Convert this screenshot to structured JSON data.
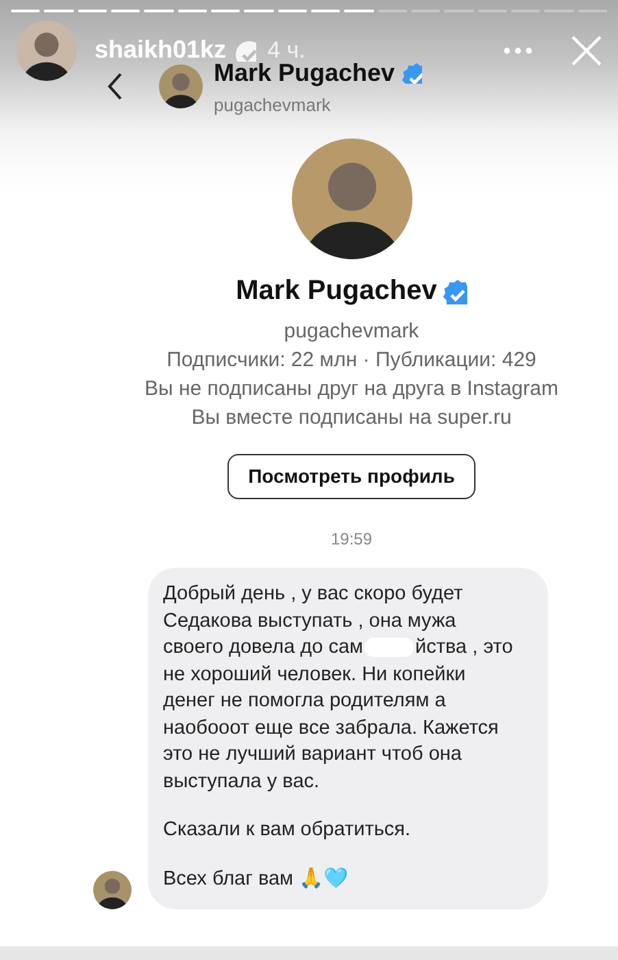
{
  "story_progress": [
    {
      "seen": true
    },
    {
      "seen": true
    },
    {
      "seen": true
    },
    {
      "seen": true
    },
    {
      "seen": true
    },
    {
      "seen": true
    },
    {
      "seen": true
    },
    {
      "seen": true
    },
    {
      "seen": true
    },
    {
      "seen": true
    },
    {
      "seen": true
    },
    {
      "seen": false
    },
    {
      "seen": false
    },
    {
      "seen": false
    },
    {
      "seen": false
    },
    {
      "seen": false
    },
    {
      "seen": false
    },
    {
      "seen": false
    }
  ],
  "story_header": {
    "username": "shaikh01kz",
    "verified": true,
    "time": "4 ч."
  },
  "chat_header": {
    "name": "Mark Pugachev",
    "verified": true,
    "handle": "pugachevmark"
  },
  "profile": {
    "name": "Mark Pugachev",
    "verified": true,
    "handle": "pugachevmark",
    "stats": "Подписчики: 22 млн · Публикации: 429",
    "info": [
      "Вы не подписаны друг на друга в Instagram",
      "Вы вместе подписаны на super.ru"
    ],
    "button": "Посмотреть профиль"
  },
  "timestamp": "19:59",
  "message": {
    "lines": [
      {
        "text": "Добрый день , у вас скоро будет"
      },
      {
        "text": "Седакова выступать , она мужа"
      },
      {
        "text": "своего довела до сам",
        "covered": true,
        "after": "йства , это"
      },
      {
        "text": "не хороший человек. Ни копейки"
      },
      {
        "text": "денег не помогла родителям а"
      },
      {
        "text": "наобооот еще все забрала. Кажется"
      },
      {
        "text": "это не лучший вариант чтоб она"
      },
      {
        "text": "выступала у вас."
      },
      {
        "text": "Сказали к вам обратиться.",
        "gap": true
      },
      {
        "text": "Всех благ вам 🙏🩵",
        "gap": true
      }
    ]
  }
}
